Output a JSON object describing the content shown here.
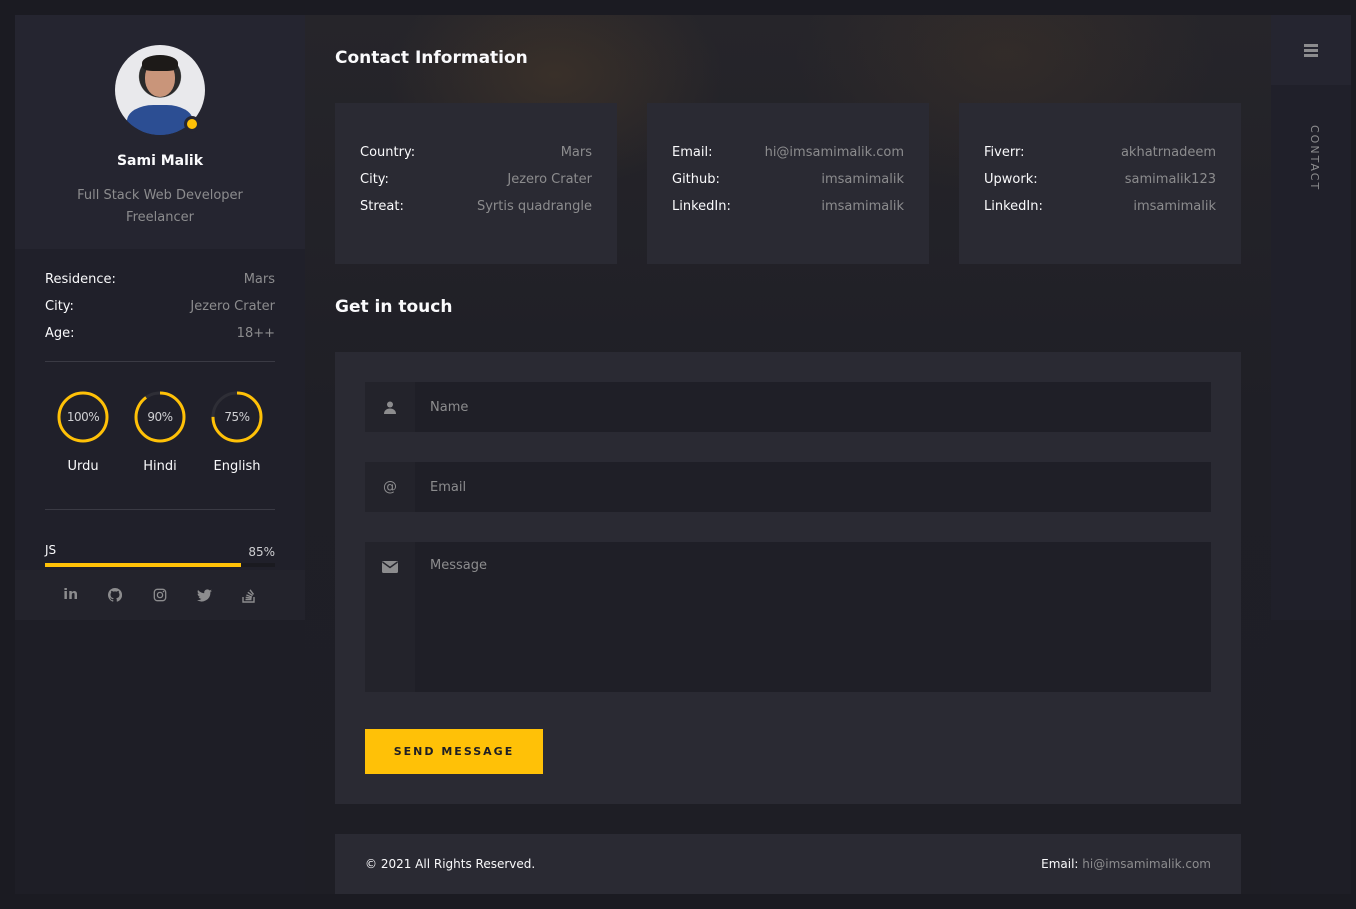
{
  "profile": {
    "name": "Sami Malik",
    "role_line1": "Full Stack Web Developer",
    "role_line2": "Freelancer",
    "status_color": "#ffc107"
  },
  "sidebar_info": [
    {
      "label": "Residence:",
      "value": "Mars"
    },
    {
      "label": "City:",
      "value": "Jezero Crater"
    },
    {
      "label": "Age:",
      "value": "18++"
    }
  ],
  "languages": [
    {
      "name": "Urdu",
      "percent_label": "100%",
      "level": 1.0
    },
    {
      "name": "Hindi",
      "percent_label": "90%",
      "level": 0.9
    },
    {
      "name": "English",
      "percent_label": "75%",
      "level": 0.75
    }
  ],
  "skills": [
    {
      "name": "JS",
      "percent_label": "85%",
      "level": 0.85
    }
  ],
  "socials": [
    "linkedin-icon",
    "github-icon",
    "instagram-icon",
    "twitter-icon",
    "stackoverflow-icon"
  ],
  "contact_section": {
    "title": "Contact Information",
    "cards": [
      {
        "rows": [
          {
            "label": "Country:",
            "value": "Mars"
          },
          {
            "label": "City:",
            "value": "Jezero Crater"
          },
          {
            "label": "Streat:",
            "value": "Syrtis quadrangle"
          }
        ]
      },
      {
        "rows": [
          {
            "label": "Email:",
            "value": "hi@imsamimalik.com"
          },
          {
            "label": "Github:",
            "value": "imsamimalik"
          },
          {
            "label": "LinkedIn:",
            "value": "imsamimalik"
          }
        ]
      },
      {
        "rows": [
          {
            "label": "Fiverr:",
            "value": "akhatrnadeem"
          },
          {
            "label": "Upwork:",
            "value": "samimalik123"
          },
          {
            "label": "LinkedIn:",
            "value": "imsamimalik"
          }
        ]
      }
    ]
  },
  "form": {
    "title": "Get in touch",
    "name_placeholder": "Name",
    "email_placeholder": "Email",
    "email_icon": "@",
    "message_placeholder": "Message",
    "send_label": "SEND MESSAGE"
  },
  "footer": {
    "copyright": "© 2021 All Rights Reserved.",
    "email_label": "Email:",
    "email_value": "hi@imsamimalik.com"
  },
  "rail": {
    "label": "CONTACT"
  },
  "colors": {
    "accent": "#ffc107",
    "panel": "#2a2a33",
    "background": "#1e1e26"
  }
}
